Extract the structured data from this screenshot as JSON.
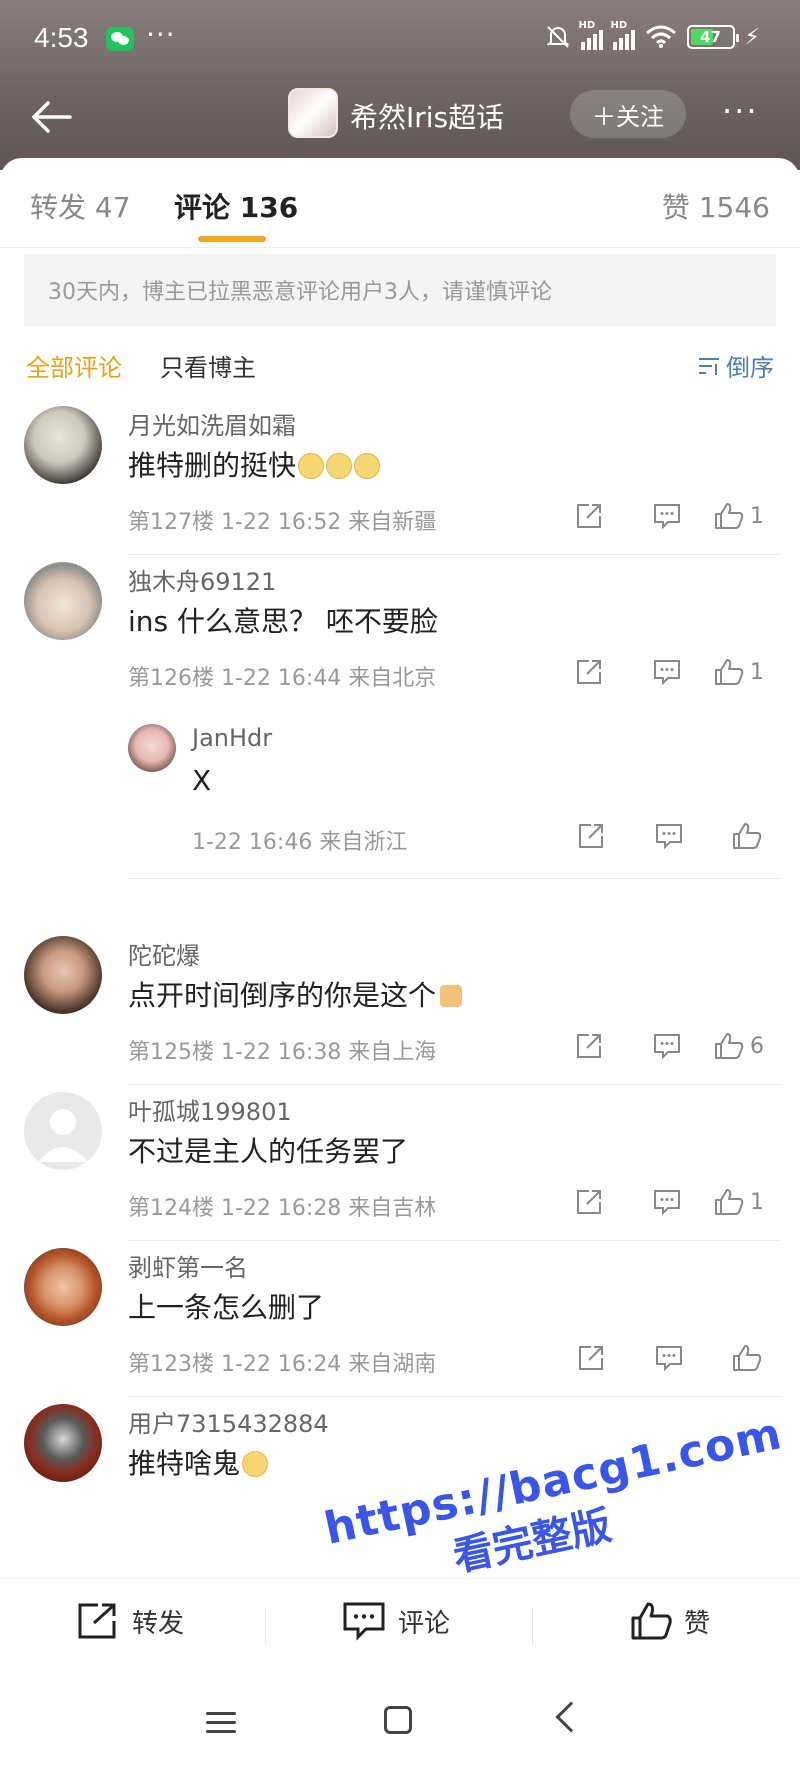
{
  "status_bar": {
    "time": "4:53",
    "dots": "···",
    "battery": "47"
  },
  "header": {
    "topic_title": "希然Iris超话",
    "follow_label": "＋关注",
    "more": "···"
  },
  "tabs": {
    "repost": "转发 47",
    "comment": "评论 136",
    "like": "赞 1546"
  },
  "notice": "30天内，博主已拉黑恶意评论用户3人，请谨慎评论",
  "filters": {
    "all": "全部评论",
    "author_only": "只看博主",
    "sort": "倒序"
  },
  "comments": [
    {
      "name": "月光如洗眉如霜",
      "text": "推特删的挺快",
      "meta": "第127楼 1-22 16:52 来自新疆",
      "likes": "1"
    },
    {
      "name": "独木舟69121",
      "text": "ins 什么意思？ 呸不要脸",
      "meta": "第126楼 1-22 16:44 来自北京",
      "likes": "1",
      "reply": {
        "name": "JanHdr",
        "text": "X",
        "meta": "1-22 16:46 来自浙江"
      }
    },
    {
      "name": "陀砣爆",
      "text": "点开时间倒序的你是这个",
      "meta": "第125楼 1-22 16:38 来自上海",
      "likes": "6"
    },
    {
      "name": "叶孤城199801",
      "text": "不过是主人的任务罢了",
      "meta": "第124楼 1-22 16:28 来自吉林",
      "likes": "1"
    },
    {
      "name": "剥虾第一名",
      "text": "上一条怎么删了",
      "meta": "第123楼 1-22 16:24 来自湖南",
      "likes": ""
    },
    {
      "name": "用户7315432884",
      "text": "推特啥鬼",
      "meta": "",
      "likes": ""
    }
  ],
  "bottom_bar": {
    "repost": "转发",
    "comment": "评论",
    "like": "赞"
  },
  "watermark": {
    "url": "https://bacg1.com",
    "text": "看完整版"
  },
  "colors": {
    "accent": "#f5a623",
    "link": "#4a7fb0",
    "watermark": "#3a56e8"
  }
}
